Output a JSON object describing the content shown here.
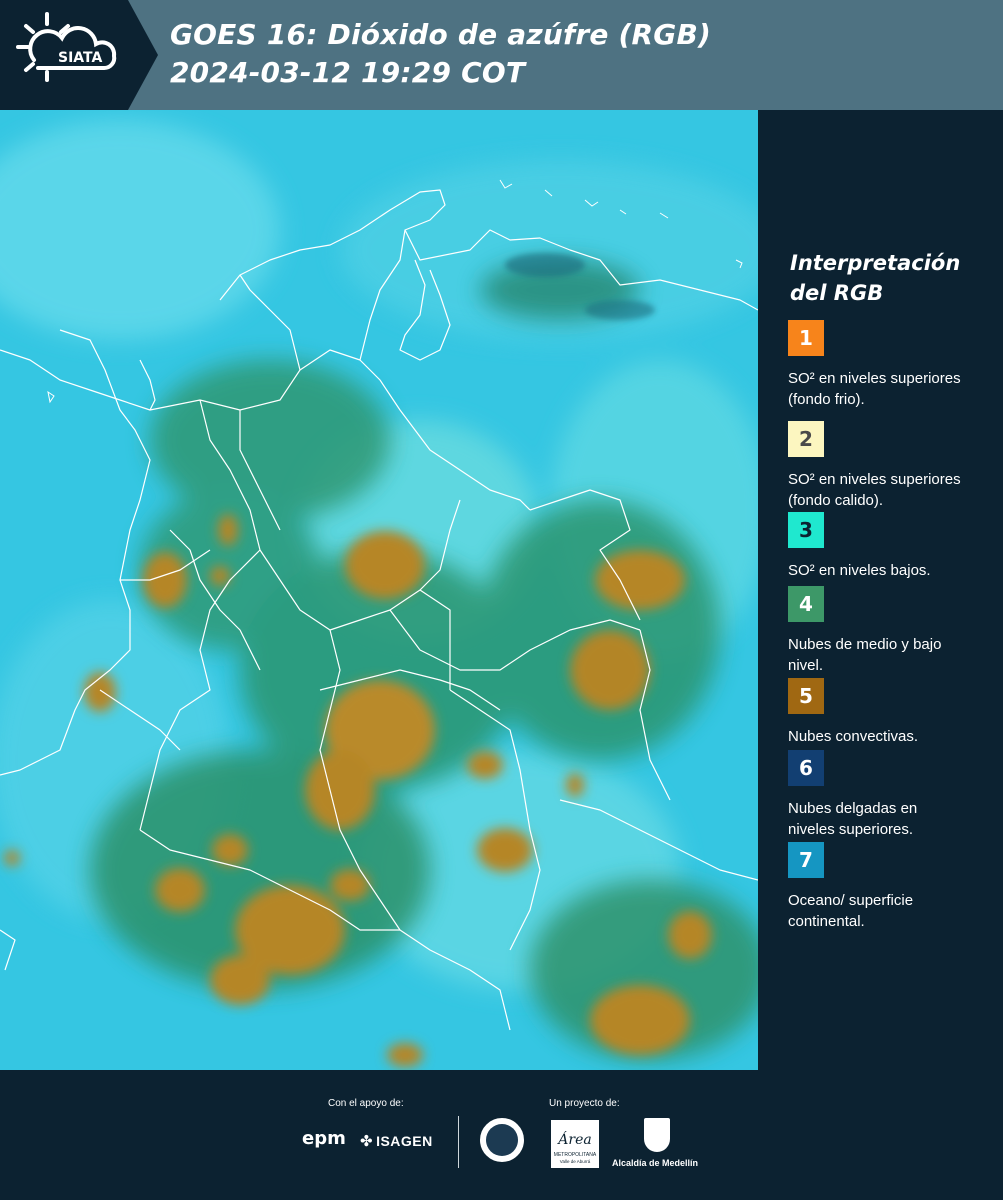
{
  "header": {
    "logo_text": "SIATA",
    "title_line1": "GOES 16: Dióxido de azúfre (RGB)",
    "title_line2": " 2024-03-12 19:29 COT",
    "band_color": "#4e7282",
    "logo_band_color": "#0c2231"
  },
  "legend": {
    "title_line1": "Interpretación",
    "title_line2": "del RGB",
    "items": [
      {
        "number": "1",
        "color": "#f7841b",
        "text_color": "#ffffff",
        "label": "SO² en niveles superiores (fondo frio)."
      },
      {
        "number": "2",
        "color": "#fcf6c0",
        "text_color": "#4a4a4a",
        "label": "SO² en niveles superiores (fondo calido)."
      },
      {
        "number": "3",
        "color": "#1fe8cf",
        "text_color": "#0c2231",
        "label": "SO² en niveles bajos."
      },
      {
        "number": "4",
        "color": "#3d9868",
        "text_color": "#ffffff",
        "label": "Nubes de medio y bajo nivel."
      },
      {
        "number": "5",
        "color": "#a06812",
        "text_color": "#ffffff",
        "label": "Nubes convectivas."
      },
      {
        "number": "6",
        "color": "#123f72",
        "text_color": "#ffffff",
        "label": "Nubes delgadas en niveles superiores."
      },
      {
        "number": "7",
        "color": "#1596c2",
        "text_color": "#ffffff",
        "label": "Oceano/ superficie continental."
      }
    ]
  },
  "map": {
    "ocean_color": "#35c6e2",
    "land_color": "#57d2de",
    "cloud_color": "#b58627",
    "mid_cloud_color": "#2e9873",
    "border_color": "#ffffff"
  },
  "footer": {
    "support_label": "Con el apoyo de:",
    "project_label": "Un proyecto de:",
    "epm": "epm",
    "isagen": "ISAGEN",
    "area_logo_title": "Área",
    "area_logo_subtitle": "METROPOLITANA",
    "area_logo_subtitle2": "Valle de Aburrá",
    "alcaldia": "Alcaldía de Medellín"
  }
}
